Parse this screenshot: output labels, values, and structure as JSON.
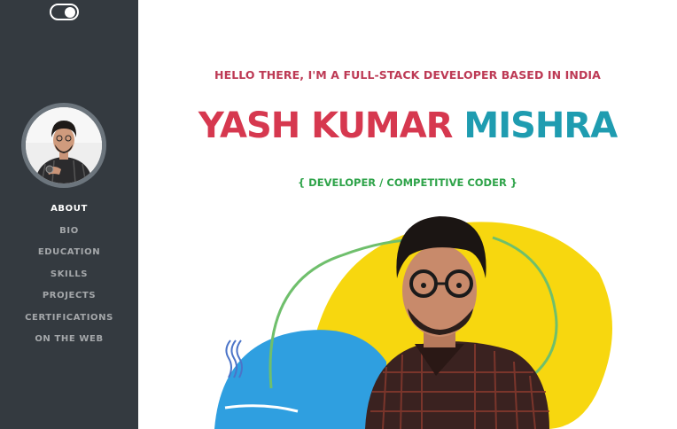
{
  "theme_toggle": {
    "state": "on"
  },
  "sidebar": {
    "nav": [
      {
        "label": "ABOUT",
        "active": true
      },
      {
        "label": "BIO",
        "active": false
      },
      {
        "label": "EDUCATION",
        "active": false
      },
      {
        "label": "SKILLS",
        "active": false
      },
      {
        "label": "PROJECTS",
        "active": false
      },
      {
        "label": "CERTIFICATIONS",
        "active": false
      },
      {
        "label": "ON THE WEB",
        "active": false
      }
    ]
  },
  "main": {
    "greeting": "HELLO THERE, I'M A FULL-STACK DEVELOPER BASED IN INDIA",
    "name_first": "YASH KUMAR",
    "name_last": "MISHRA",
    "role": "{ DEVELOPER / COMPETITIVE CODER }"
  },
  "colors": {
    "sidebar_bg": "#343a40",
    "greeting": "#bd3a55",
    "name_first": "#d6384f",
    "name_last": "#1f9cb0",
    "role": "#2ea349",
    "blob_yellow": "#f7d70f",
    "blob_blue": "#2f9fe0",
    "ring_green": "#6fbf6c"
  }
}
